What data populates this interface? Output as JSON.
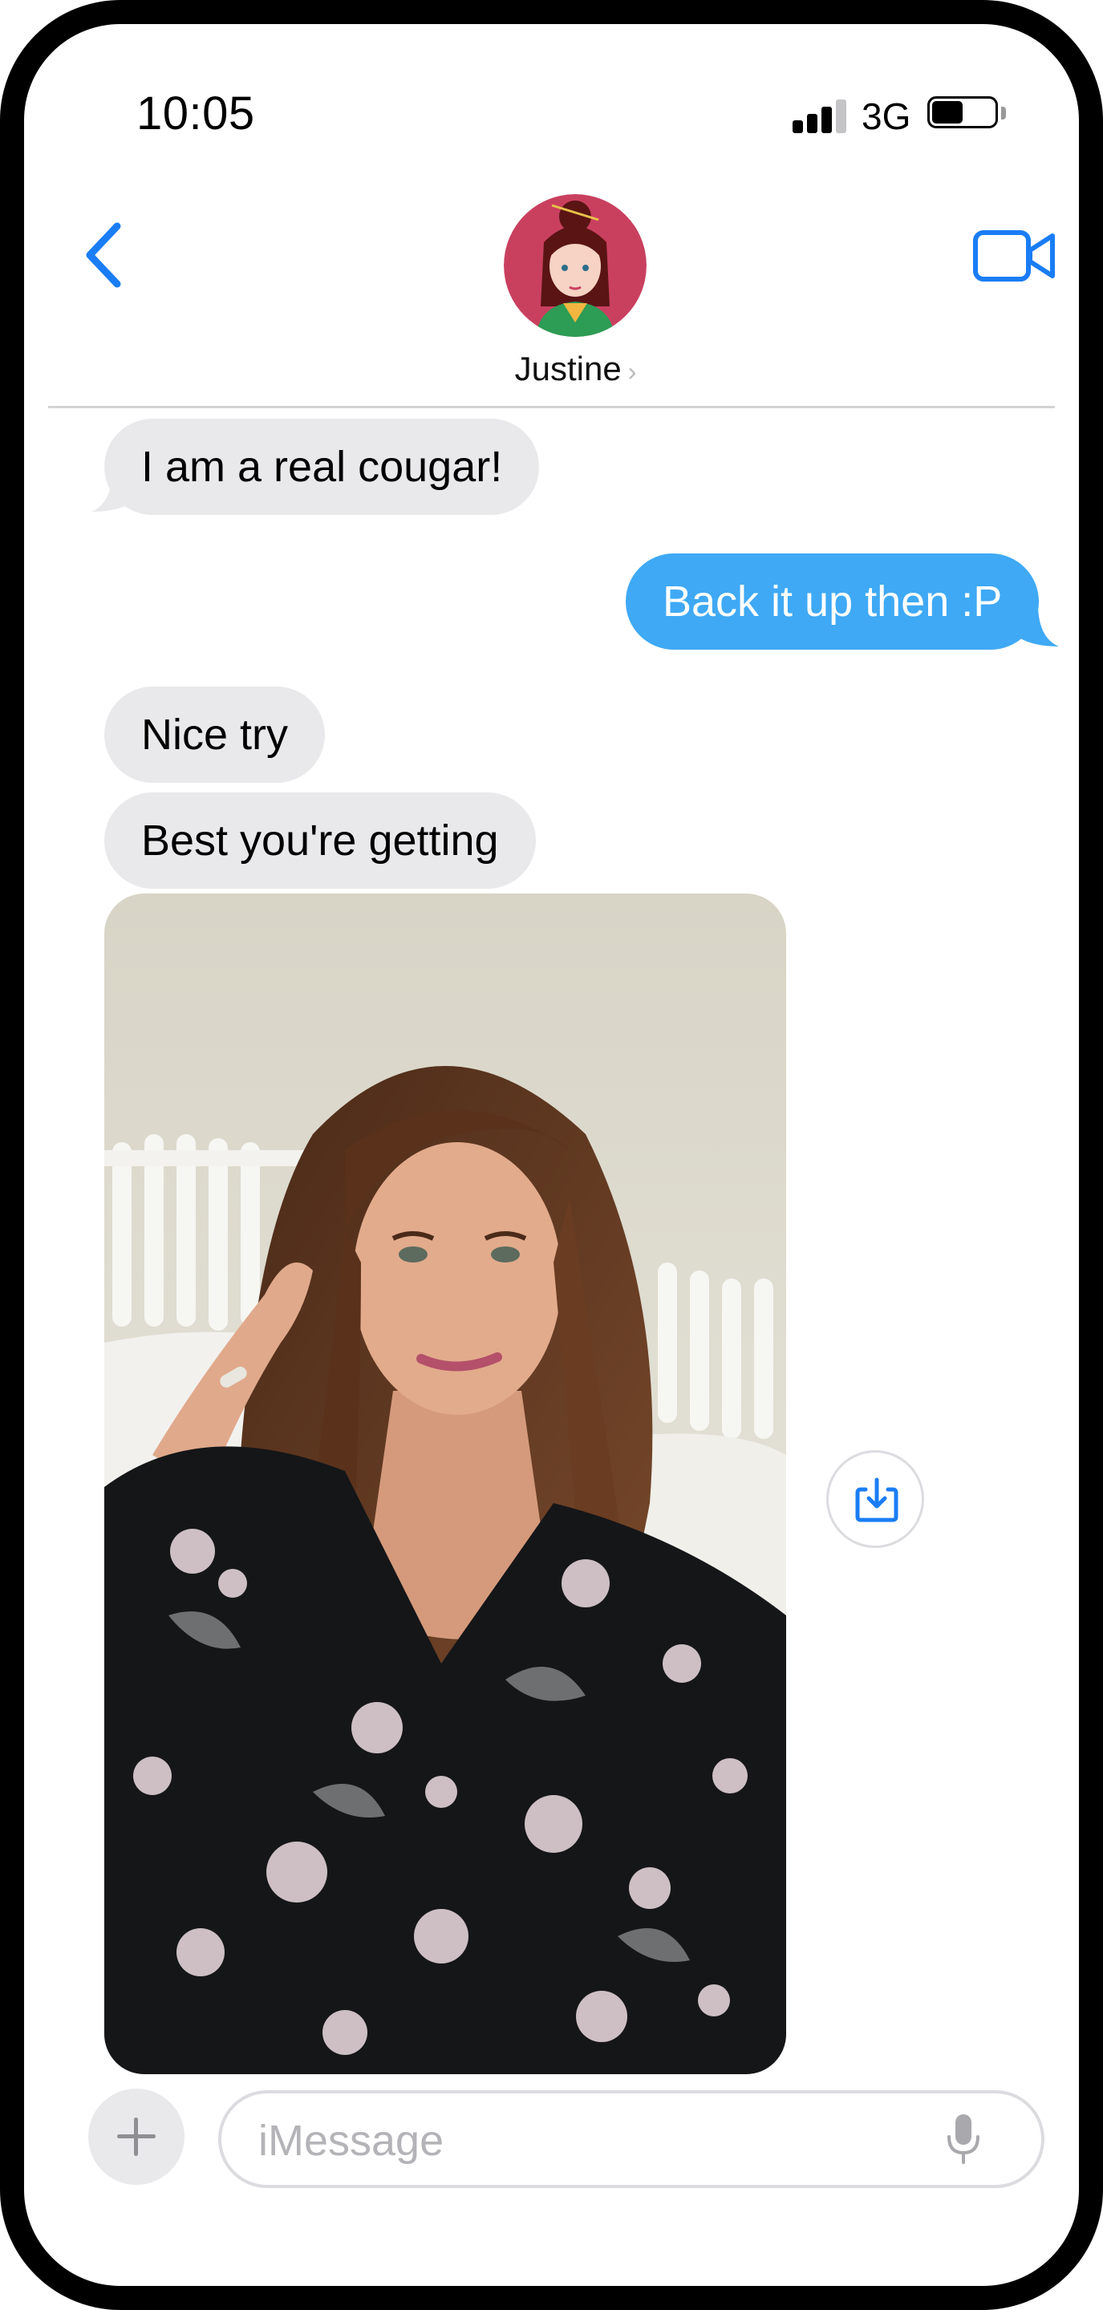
{
  "status_bar": {
    "time": "10:05",
    "network": "3G",
    "signal_bars": 3,
    "battery_level": 0.45
  },
  "header": {
    "contact_name": "Justine",
    "avatar_icon": "cartoon-woman-avatar",
    "back_icon": "chevron-left-icon",
    "video_icon": "video-camera-icon",
    "accent_color": "#1a7df5"
  },
  "messages": [
    {
      "side": "incoming",
      "text": "I am a real cougar!"
    },
    {
      "side": "outgoing",
      "text": "Back it up then :P"
    },
    {
      "side": "incoming",
      "text": "Nice try"
    },
    {
      "side": "incoming",
      "text": "Best you're getting"
    },
    {
      "side": "incoming",
      "type": "photo",
      "icon": "photo-attachment"
    }
  ],
  "colors": {
    "incoming_bubble": "#e9e9eb",
    "outgoing_bubble": "#3fa9f5"
  },
  "compose": {
    "placeholder": "iMessage",
    "add_icon": "plus-icon",
    "mic_icon": "microphone-icon"
  }
}
